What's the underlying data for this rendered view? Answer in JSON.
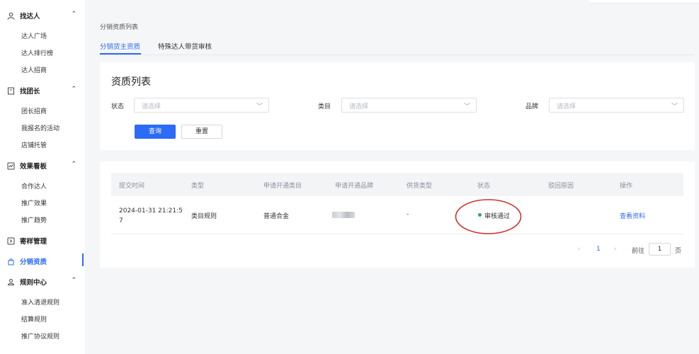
{
  "sidebar": {
    "groups": [
      {
        "label": "找达人",
        "icon": "user-icon",
        "items": [
          "达人广场",
          "达人排行榜",
          "达人招商"
        ]
      },
      {
        "label": "找团长",
        "icon": "flag-icon",
        "items": [
          "团长招商",
          "我报名的活动",
          "店铺托管"
        ]
      },
      {
        "label": "效果看板",
        "icon": "chart-icon",
        "items": [
          "合作达人",
          "推广效果",
          "推广趋势"
        ]
      },
      {
        "label": "寄样管理",
        "icon": "sample-icon",
        "items": []
      },
      {
        "label": "分销资质",
        "icon": "bag-icon",
        "items": [],
        "active": true
      },
      {
        "label": "规则中心",
        "icon": "rules-icon",
        "items": [
          "准入清退规则",
          "结算规则",
          "推广协议规则"
        ]
      }
    ]
  },
  "breadcrumb": "分销资质列表",
  "tabs": [
    "分销货主资质",
    "特殊达人带货审核"
  ],
  "filter": {
    "title": "资质列表",
    "fields": [
      {
        "label": "状态",
        "placeholder": "请选择"
      },
      {
        "label": "类目",
        "placeholder": "请选择"
      },
      {
        "label": "品牌",
        "placeholder": "请选择"
      }
    ],
    "query_label": "查询",
    "reset_label": "重置"
  },
  "table": {
    "headers": [
      "提交时间",
      "类型",
      "申请开通类目",
      "申请开通品牌",
      "供货类型",
      "状态",
      "驳回原因",
      "操作"
    ],
    "rows": [
      {
        "time_line1": "2024-01-31 21:21:5",
        "time_line2": "7",
        "type": "类目规则",
        "category": "普通合金",
        "brand": "",
        "supply": "-",
        "status": "审核通过",
        "reason": "",
        "action": "查看资料"
      }
    ]
  },
  "pagination": {
    "prev": "‹",
    "page": "1",
    "next": "›",
    "goto_label": "前往",
    "goto_value": "1",
    "suffix": "页"
  },
  "colors": {
    "primary": "#2c6bf5",
    "success": "#20b35a",
    "annotation": "#d0312d"
  }
}
